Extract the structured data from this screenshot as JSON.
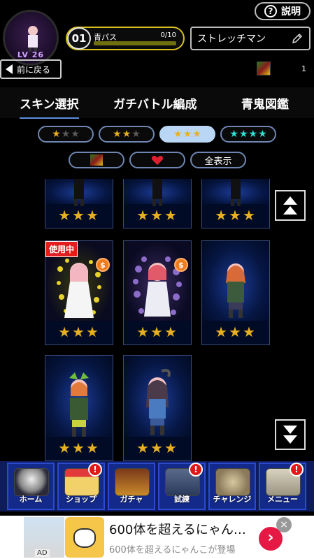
{
  "profile": {
    "level": "LV 26"
  },
  "help": {
    "label": "説明"
  },
  "pass": {
    "number": "01",
    "label": "青パス",
    "progress_text": "0/10",
    "progress_fraction": 0
  },
  "player": {
    "name": "ストレッチマン"
  },
  "nav": {
    "back_label": "前に戻る"
  },
  "inventory": {
    "count": "1"
  },
  "tabs": [
    "スキン選択",
    "ガチバトル編成",
    "青鬼図鑑"
  ],
  "filters": {
    "row2": {
      "all_label": "全表示"
    }
  },
  "cards": {
    "in_use_label": "使用中",
    "coin_symbol": "$"
  },
  "bottom_nav": [
    {
      "label": "ホーム",
      "alert": false
    },
    {
      "label": "ショップ",
      "alert": true
    },
    {
      "label": "ガチャ",
      "alert": false
    },
    {
      "label": "試練",
      "alert": true
    },
    {
      "label": "チャレンジ",
      "alert": false
    },
    {
      "label": "メニュー",
      "alert": true
    }
  ],
  "alert_symbol": "!",
  "ad": {
    "title": "600体を超えるにゃん…",
    "subtitle": "600体を超えるにゃんこが登場",
    "ad_label": "AD",
    "close": "×",
    "go": "›"
  },
  "colors": {
    "accent_blue": "#5a8fdc",
    "star_gold": "#e8b020",
    "star_cyan": "#31e1d4",
    "pass_yellow": "#d8c020",
    "alert_red": "#e01818"
  }
}
